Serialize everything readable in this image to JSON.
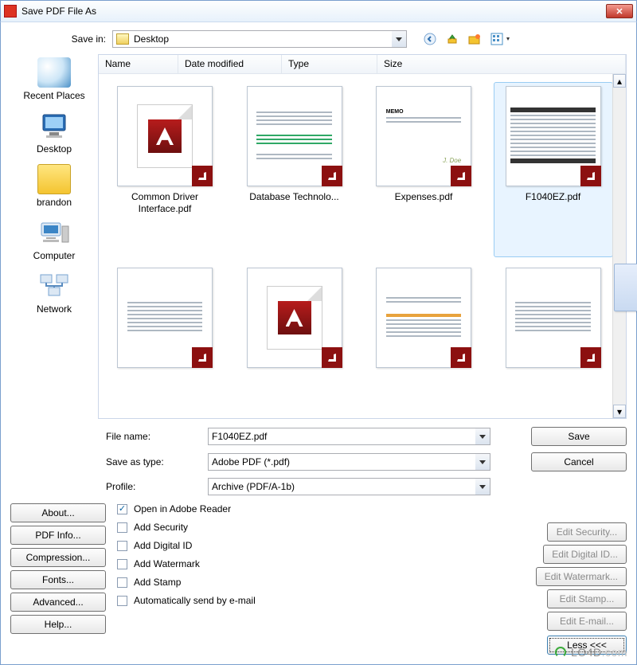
{
  "window": {
    "title": "Save PDF File As"
  },
  "savein": {
    "label": "Save in:",
    "value": "Desktop"
  },
  "columns": {
    "name": "Name",
    "date": "Date modified",
    "type": "Type",
    "size": "Size"
  },
  "sidebar": {
    "items": [
      {
        "label": "Recent Places"
      },
      {
        "label": "Desktop"
      },
      {
        "label": "brandon"
      },
      {
        "label": "Computer"
      },
      {
        "label": "Network"
      }
    ]
  },
  "files": [
    {
      "name": "Common Driver Interface.pdf",
      "selected": false,
      "style": "adobe"
    },
    {
      "name": "Database Technolo...",
      "selected": false,
      "style": "text_green"
    },
    {
      "name": "Expenses.pdf",
      "selected": false,
      "style": "memo"
    },
    {
      "name": "F1040EZ.pdf",
      "selected": true,
      "style": "form"
    },
    {
      "name": "",
      "selected": false,
      "style": "text"
    },
    {
      "name": "",
      "selected": false,
      "style": "adobe"
    },
    {
      "name": "",
      "selected": false,
      "style": "text_orange"
    },
    {
      "name": "",
      "selected": false,
      "style": "text"
    }
  ],
  "fields": {
    "filename_label": "File name:",
    "filename_value": "F1040EZ.pdf",
    "saveastype_label": "Save as type:",
    "saveastype_value": "Adobe PDF (*.pdf)",
    "profile_label": "Profile:",
    "profile_value": "Archive (PDF/A-1b)"
  },
  "actions": {
    "save": "Save",
    "cancel": "Cancel"
  },
  "left_buttons": {
    "about": "About...",
    "pdfinfo": "PDF Info...",
    "compression": "Compression...",
    "fonts": "Fonts...",
    "advanced": "Advanced...",
    "help": "Help..."
  },
  "options": {
    "open_reader": "Open in Adobe Reader",
    "add_security": "Add Security",
    "add_digitalid": "Add Digital ID",
    "add_watermark": "Add Watermark",
    "add_stamp": "Add Stamp",
    "auto_email": "Automatically send by e-mail"
  },
  "edit_buttons": {
    "security": "Edit Security...",
    "digitalid": "Edit Digital ID...",
    "watermark": "Edit Watermark...",
    "stamp": "Edit Stamp...",
    "email": "Edit E-mail..."
  },
  "less_button": "Less <<<",
  "watermark_text": {
    "lo": "LO4D",
    "dotcom": ".com"
  }
}
